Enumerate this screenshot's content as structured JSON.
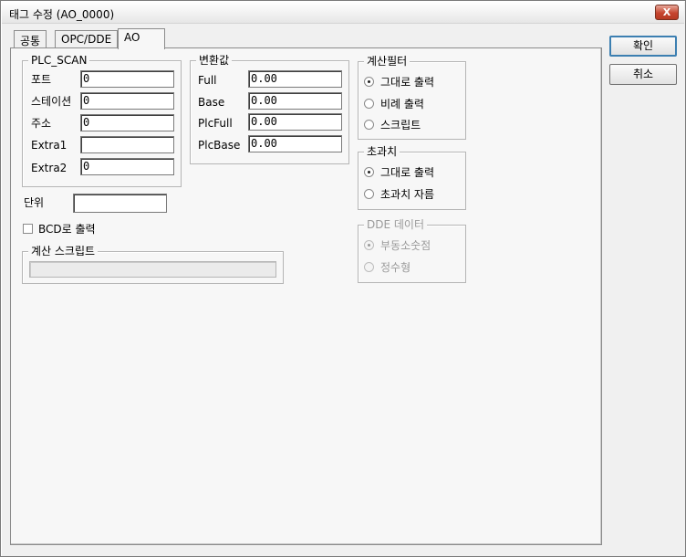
{
  "window": {
    "title": "태그 수정 (AO_0000)",
    "close_label": "X"
  },
  "tabs": [
    {
      "label": "공통"
    },
    {
      "label": "OPC/DDE"
    },
    {
      "label": "AO"
    }
  ],
  "buttons": {
    "ok": "확인",
    "cancel": "취소"
  },
  "plc_scan": {
    "title": "PLC_SCAN",
    "fields": [
      {
        "label": "포트",
        "value": "0"
      },
      {
        "label": "스테이션",
        "value": "0"
      },
      {
        "label": "주소",
        "value": "0"
      },
      {
        "label": "Extra1",
        "value": ""
      },
      {
        "label": "Extra2",
        "value": "0"
      }
    ]
  },
  "conversion": {
    "title": "변환값",
    "fields": [
      {
        "label": "Full",
        "value": "0.00"
      },
      {
        "label": "Base",
        "value": "0.00"
      },
      {
        "label": "PlcFull",
        "value": "0.00"
      },
      {
        "label": "PlcBase",
        "value": "0.00"
      }
    ]
  },
  "unit": {
    "label": "단위",
    "value": ""
  },
  "bcd_output": {
    "label": "BCD로 출력",
    "checked": false
  },
  "calc_script": {
    "title": "계산 스크립트",
    "value": ""
  },
  "calc_filter": {
    "title": "계산필터",
    "options": [
      {
        "label": "그대로 출력",
        "checked": true
      },
      {
        "label": "비례 출력",
        "checked": false
      },
      {
        "label": "스크립트",
        "checked": false
      }
    ]
  },
  "overflow": {
    "title": "초과치",
    "options": [
      {
        "label": "그대로 출력",
        "checked": true
      },
      {
        "label": "초과치 자름",
        "checked": false
      }
    ]
  },
  "dde_data": {
    "title": "DDE 데이터",
    "enabled": false,
    "options": [
      {
        "label": "부동소숫점",
        "checked": true
      },
      {
        "label": "정수형",
        "checked": false
      }
    ]
  }
}
